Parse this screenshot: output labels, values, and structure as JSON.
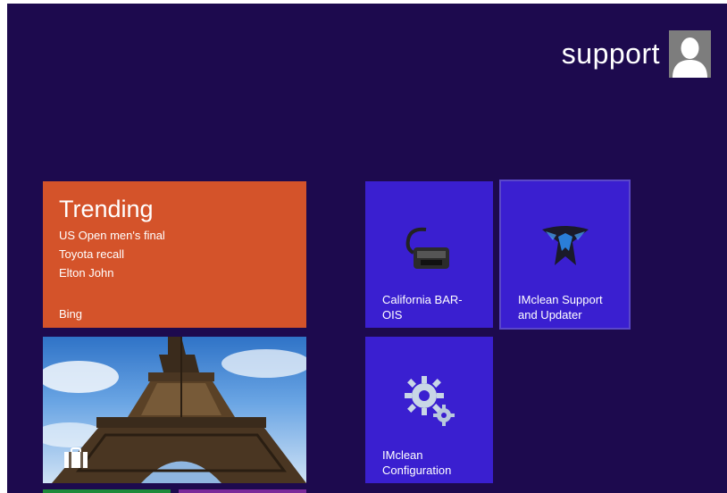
{
  "user": {
    "name": "support",
    "avatar_icon": "user-silhouette-icon"
  },
  "tiles": {
    "trending": {
      "title": "Trending",
      "items": [
        "US Open men's final",
        "Toyota recall",
        "Elton John"
      ],
      "footer": "Bing",
      "color": "#d4532a"
    },
    "photo": {
      "subject": "eiffel-tower-photo",
      "badge_icon": "shopping-bag-icon"
    },
    "california_bar": {
      "label_line1": "California BAR-",
      "label_line2": "OIS",
      "icon": "obd-cable-icon",
      "color": "#3a1fd0"
    },
    "imclean_support": {
      "label_line1": "IMclean Support",
      "label_line2": "and Updater",
      "icon": "imclean-logo-icon"
    },
    "imclean_config": {
      "label_line1": "IMclean",
      "label_line2": "Configuration",
      "icon": "gears-icon"
    }
  },
  "colors": {
    "background": "#1d0a4e",
    "app_tile": "#3a1fd0"
  }
}
